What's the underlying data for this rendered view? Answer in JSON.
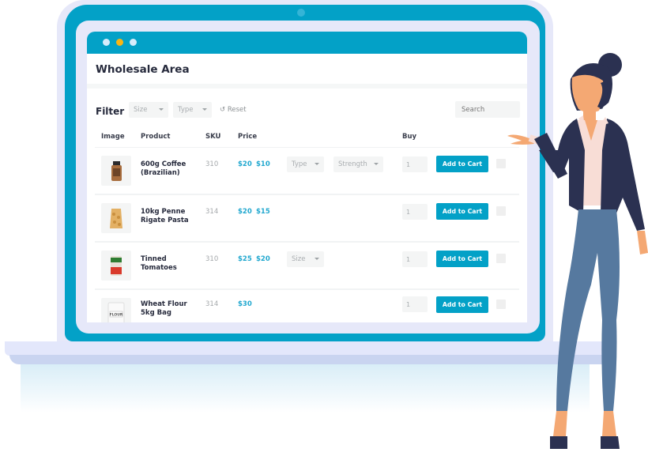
{
  "window": {
    "title": "Wholesale Area",
    "controls": [
      "close-dot",
      "minimize-dot",
      "maximize-dot"
    ]
  },
  "filter": {
    "label": "Filter",
    "size_select": "Size",
    "type_select": "Type",
    "reset_label": "Reset",
    "reset_icon": "undo-icon",
    "search_placeholder": "Search"
  },
  "table": {
    "columns": [
      "Image",
      "Product",
      "SKU",
      "Price",
      "Buy"
    ],
    "rows": [
      {
        "image": "coffee-jar-image",
        "product": "600g Coffee (Brazilian)",
        "product_line1": "600g Coffee",
        "product_line2": "(Brazilian)",
        "sku": "310",
        "price_old": "$20",
        "price_new": "$10",
        "options": [
          "Type",
          "Strength"
        ],
        "quantity": "1",
        "button": "Add to Cart"
      },
      {
        "image": "pasta-bag-image",
        "product": "10kg Penne Rigate Pasta",
        "product_line1": "10kg Penne",
        "product_line2": "Rigate Pasta",
        "sku": "314",
        "price_old": "$20",
        "price_new": "$15",
        "options": [],
        "quantity": "1",
        "button": "Add to Cart"
      },
      {
        "image": "tomato-can-image",
        "product": "Tinned Tomatoes",
        "product_line1": "Tinned",
        "product_line2": "Tomatoes",
        "sku": "310",
        "price_old": "$25",
        "price_new": "$20",
        "options": [
          "Size"
        ],
        "quantity": "1",
        "button": "Add to Cart"
      },
      {
        "image": "flour-bag-image",
        "product": "Wheat Flour 5kg Bag",
        "product_line1": "Wheat Flour",
        "product_line2": "5kg Bag",
        "sku": "314",
        "price_old": "$30",
        "price_new": "",
        "flour_label": "FLOUR",
        "options": [],
        "quantity": "1",
        "button": "Add to Cart"
      }
    ]
  },
  "colors": {
    "accent": "#03a1c7",
    "price": "#22a8cf",
    "title_dot_yellow": "#fbb512",
    "frame_lavender": "#e6e8f9",
    "person_jacket": "#2b3151",
    "person_jeans": "#56799f",
    "person_skin": "#f4a873"
  },
  "illustration": {
    "person": "woman-presenting-illustration"
  }
}
